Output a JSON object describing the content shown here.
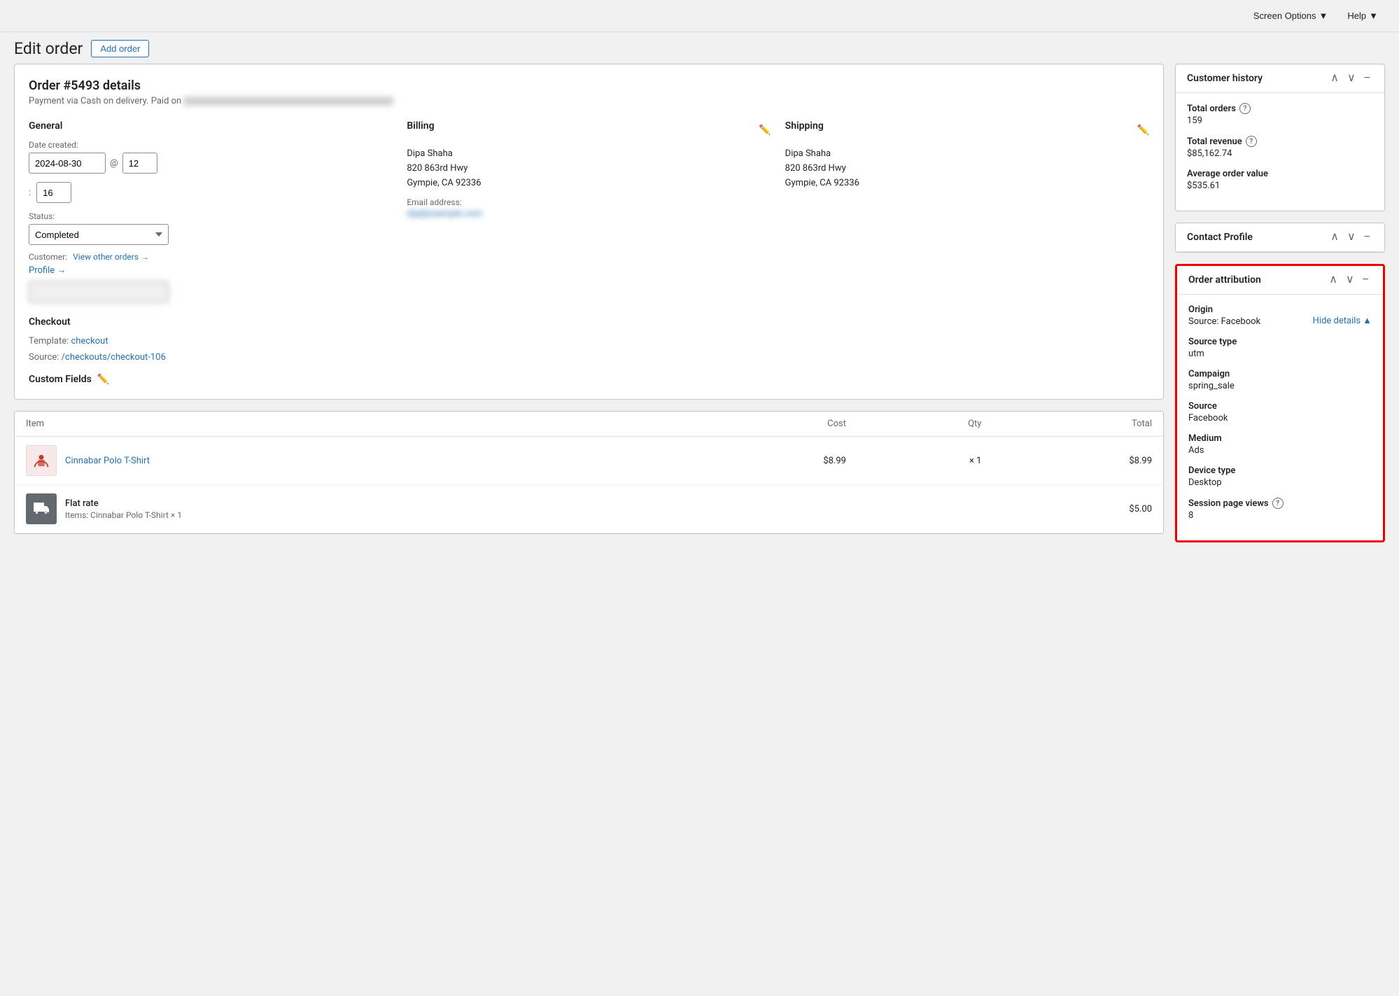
{
  "topBar": {
    "screenOptions": "Screen Options",
    "help": "Help"
  },
  "header": {
    "title": "Edit order",
    "addOrderBtn": "Add order"
  },
  "orderDetails": {
    "title": "Order #5493 details",
    "subtitle": "Payment via Cash on delivery. Paid on",
    "general": {
      "label": "General",
      "dateLabel": "Date created:",
      "dateValue": "2024-08-30",
      "atSymbol": "@",
      "hour": "12",
      "colon": ":",
      "minute": "16",
      "statusLabel": "Status:",
      "statusValue": "Completed",
      "customerLabel": "Customer:",
      "viewOtherOrders": "View other orders →",
      "profile": "Profile →"
    },
    "billing": {
      "label": "Billing",
      "name": "Dipa Shaha",
      "address1": "820 863rd Hwy",
      "city": "Gympie, CA 92336",
      "emailLabel": "Email address:",
      "emailValue": "dip..."
    },
    "shipping": {
      "label": "Shipping",
      "name": "Dipa Shaha",
      "address1": "820 863rd Hwy",
      "city": "Gympie, CA 92336"
    },
    "checkout": {
      "label": "Checkout",
      "templateLabel": "Template:",
      "templateLink": "checkout",
      "sourceLabel": "Source:",
      "sourceLink": "/checkouts/checkout-106"
    },
    "customFields": "Custom Fields"
  },
  "itemsTable": {
    "columns": {
      "item": "Item",
      "cost": "Cost",
      "qty": "Qty",
      "total": "Total"
    },
    "rows": [
      {
        "name": "Cinnabar Polo T-Shirt",
        "cost": "$8.99",
        "qty": "× 1",
        "total": "$8.99",
        "type": "product"
      }
    ],
    "shipping": {
      "name": "Flat rate",
      "sub": "Items: Cinnabar Polo T-Shirt × 1",
      "total": "$5.00"
    }
  },
  "customerHistory": {
    "title": "Customer history",
    "totalOrders": {
      "label": "Total orders",
      "value": "159"
    },
    "totalRevenue": {
      "label": "Total revenue",
      "value": "$85,162.74"
    },
    "avgOrderValue": {
      "label": "Average order value",
      "value": "$535.61"
    }
  },
  "contactProfile": {
    "title": "Contact Profile"
  },
  "orderAttribution": {
    "title": "Order attribution",
    "origin": {
      "label": "Origin",
      "value": "Source: Facebook",
      "hideDetails": "Hide details"
    },
    "sourceType": {
      "label": "Source type",
      "value": "utm"
    },
    "campaign": {
      "label": "Campaign",
      "value": "spring_sale"
    },
    "source": {
      "label": "Source",
      "value": "Facebook"
    },
    "medium": {
      "label": "Medium",
      "value": "Ads"
    },
    "deviceType": {
      "label": "Device type",
      "value": "Desktop"
    },
    "sessionPageViews": {
      "label": "Session page views",
      "value": "8"
    }
  }
}
